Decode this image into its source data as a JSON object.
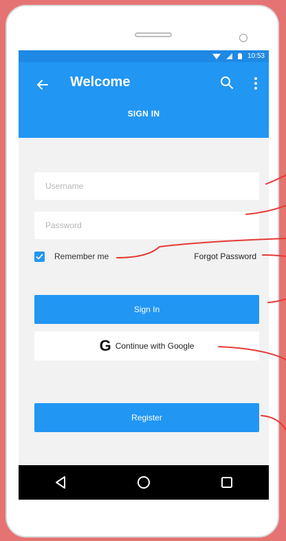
{
  "status_bar": {
    "time": "10:53"
  },
  "app_bar": {
    "title": "Welcome",
    "tab_label": "SIGN IN"
  },
  "form": {
    "username_placeholder": "Username",
    "password_placeholder": "Password",
    "remember_label": "Remember me",
    "remember_checked": true,
    "forgot_label": "Forgot Password",
    "sign_in_label": "Sign In",
    "google_label": "Continue with Google",
    "register_label": "Register"
  },
  "colors": {
    "primary": "#2196f3",
    "status_bar": "#1e88e5",
    "frame_background": "#e57373",
    "callout_line": "#e53935"
  },
  "icons": {
    "back": "arrow-left-icon",
    "search": "search-icon",
    "more": "more-vertical-icon",
    "check": "check-icon",
    "google": "google-g-icon",
    "nav_back": "triangle-back-icon",
    "nav_home": "circle-home-icon",
    "nav_recents": "square-recents-icon"
  }
}
